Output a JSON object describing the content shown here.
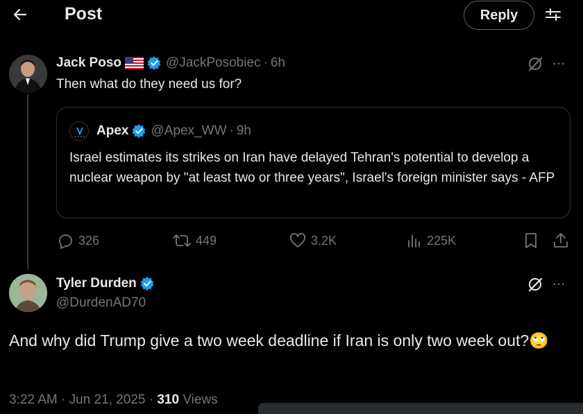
{
  "header": {
    "title": "Post",
    "reply_label": "Reply"
  },
  "post": {
    "author": {
      "name": "Jack Poso",
      "handle": "@JackPosobiec",
      "time": "6h",
      "flag": "us-flag-icon"
    },
    "text": "Then what do they need us for?",
    "quote": {
      "author": {
        "name": "Apex",
        "handle": "@Apex_WW",
        "time": "9h"
      },
      "text": "Israel estimates its strikes on Iran have delayed Tehran's potential to develop a nuclear weapon by \"at least two or three years\", Israel's foreign minister says - AFP"
    },
    "stats": {
      "replies": "326",
      "reposts": "449",
      "likes": "3.2K",
      "views": "225K"
    }
  },
  "reply": {
    "author": {
      "name": "Tyler Durden",
      "handle": "@DurdenAD70"
    },
    "text": "And why did Trump give a two week deadline if Iran is only two week out?",
    "emoji": "🙄",
    "timestamp": "3:22 AM · Jun 21, 2025 · ",
    "views_count": "310",
    "views_label": " Views"
  },
  "colors": {
    "background": "#000000",
    "text": "#e7e9ea",
    "muted": "#71767b",
    "verified": "#1d9bf0",
    "border": "#2f3336"
  }
}
